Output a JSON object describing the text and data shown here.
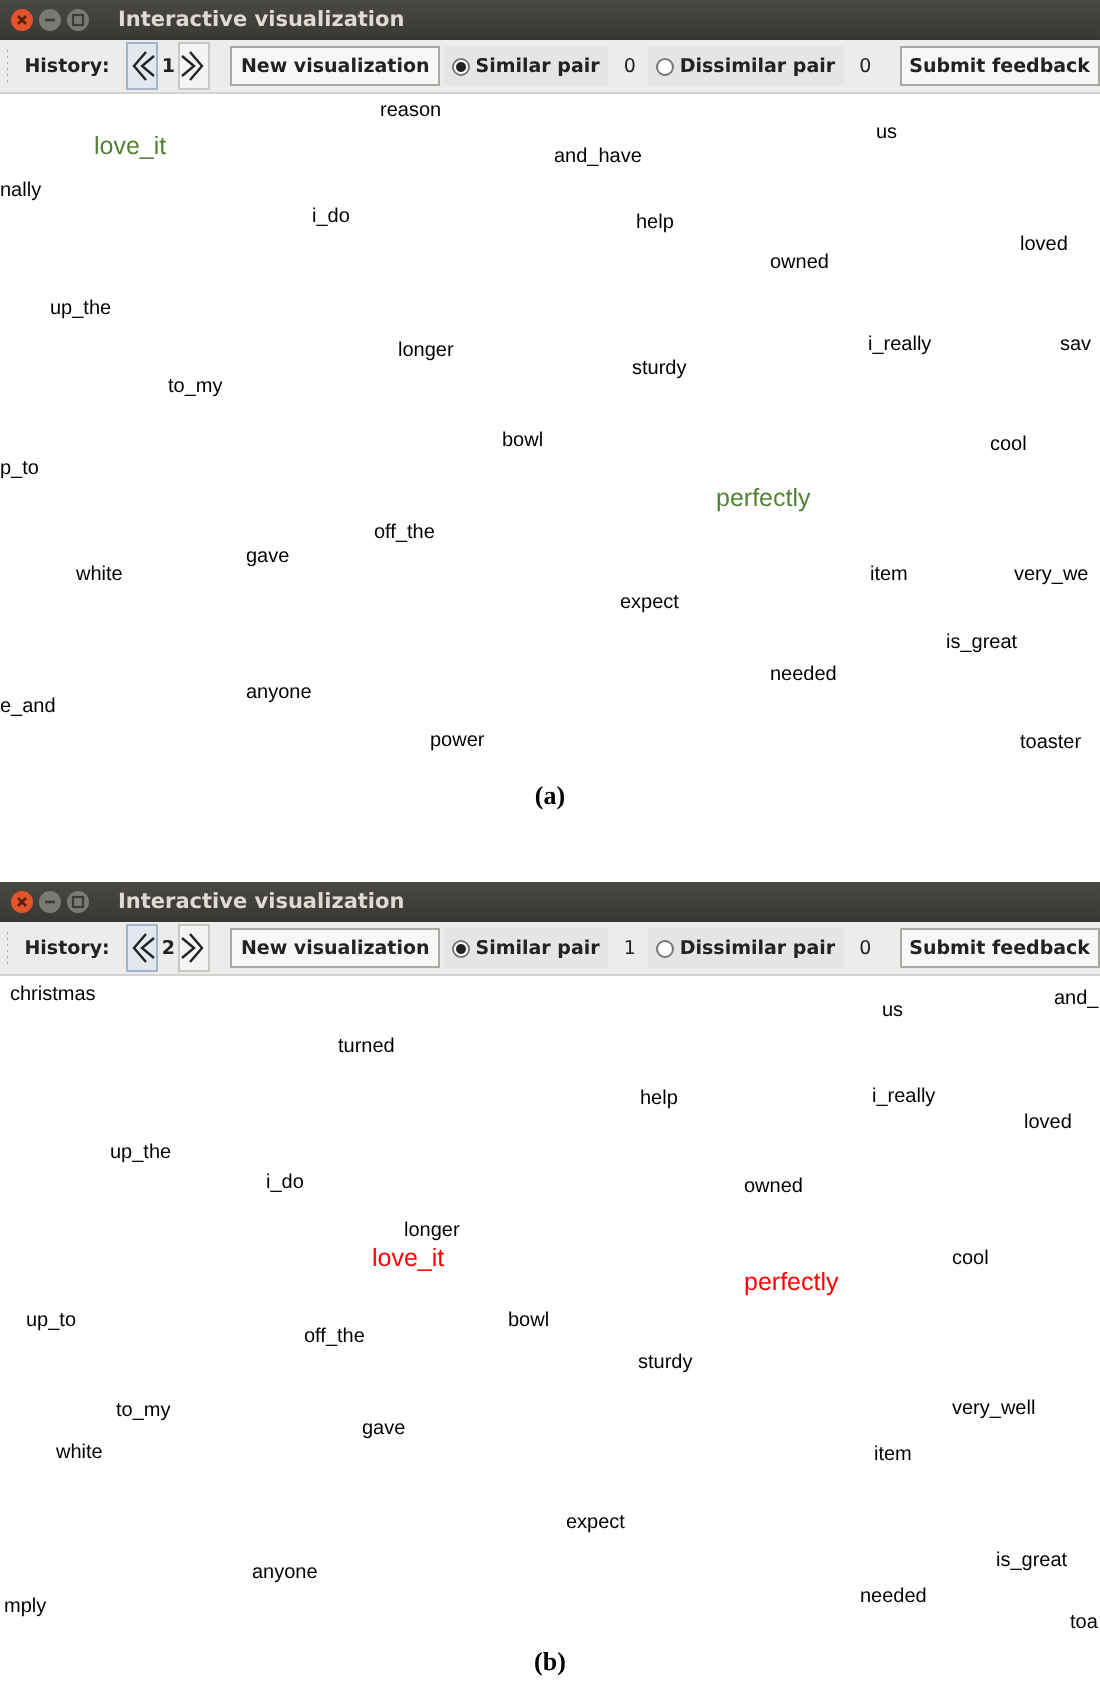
{
  "panels": [
    {
      "window": {
        "title": "Interactive visualization"
      },
      "toolbar": {
        "history_label": "History:",
        "page": "1",
        "new_button": "New visualization",
        "options": [
          {
            "label": "Similar pair",
            "selected": true,
            "count": "0"
          },
          {
            "label": "Dissimilar pair",
            "selected": false,
            "count": "0"
          }
        ],
        "submit_button": "Submit feedback"
      },
      "words": [
        {
          "text": "reason",
          "color": "#000000"
        },
        {
          "text": "love_it",
          "color": "#548235"
        },
        {
          "text": "us",
          "color": "#000000"
        },
        {
          "text": "and_have",
          "color": "#000000"
        },
        {
          "text": "nally",
          "color": "#000000"
        },
        {
          "text": "i_do",
          "color": "#000000"
        },
        {
          "text": "help",
          "color": "#000000"
        },
        {
          "text": "loved",
          "color": "#000000"
        },
        {
          "text": "owned",
          "color": "#000000"
        },
        {
          "text": "up_the",
          "color": "#000000"
        },
        {
          "text": "longer",
          "color": "#000000"
        },
        {
          "text": "i_really",
          "color": "#000000"
        },
        {
          "text": "sav",
          "color": "#000000"
        },
        {
          "text": "sturdy",
          "color": "#000000"
        },
        {
          "text": "to_my",
          "color": "#000000"
        },
        {
          "text": "bowl",
          "color": "#000000"
        },
        {
          "text": "cool",
          "color": "#000000"
        },
        {
          "text": "p_to",
          "color": "#000000"
        },
        {
          "text": "perfectly",
          "color": "#548235"
        },
        {
          "text": "off_the",
          "color": "#000000"
        },
        {
          "text": "gave",
          "color": "#000000"
        },
        {
          "text": "white",
          "color": "#000000"
        },
        {
          "text": "item",
          "color": "#000000"
        },
        {
          "text": "very_we",
          "color": "#000000"
        },
        {
          "text": "expect",
          "color": "#000000"
        },
        {
          "text": "is_great",
          "color": "#000000"
        },
        {
          "text": "needed",
          "color": "#000000"
        },
        {
          "text": "anyone",
          "color": "#000000"
        },
        {
          "text": "e_and",
          "color": "#000000"
        },
        {
          "text": "power",
          "color": "#000000"
        },
        {
          "text": "toaster",
          "color": "#000000"
        }
      ],
      "caption": "(a)"
    },
    {
      "window": {
        "title": "Interactive visualization"
      },
      "toolbar": {
        "history_label": "History:",
        "page": "2",
        "new_button": "New visualization",
        "options": [
          {
            "label": "Similar pair",
            "selected": true,
            "count": "1"
          },
          {
            "label": "Dissimilar pair",
            "selected": false,
            "count": "0"
          }
        ],
        "submit_button": "Submit feedback"
      },
      "words": [
        {
          "text": "christmas",
          "color": "#000000"
        },
        {
          "text": "us",
          "color": "#000000"
        },
        {
          "text": "and_",
          "color": "#000000"
        },
        {
          "text": "turned",
          "color": "#000000"
        },
        {
          "text": "help",
          "color": "#000000"
        },
        {
          "text": "i_really",
          "color": "#000000"
        },
        {
          "text": "loved",
          "color": "#000000"
        },
        {
          "text": "up_the",
          "color": "#000000"
        },
        {
          "text": "i_do",
          "color": "#000000"
        },
        {
          "text": "owned",
          "color": "#000000"
        },
        {
          "text": "longer",
          "color": "#000000"
        },
        {
          "text": "love_it",
          "color": "#ff0000"
        },
        {
          "text": "cool",
          "color": "#000000"
        },
        {
          "text": "perfectly",
          "color": "#ff0000"
        },
        {
          "text": "up_to",
          "color": "#000000"
        },
        {
          "text": "bowl",
          "color": "#000000"
        },
        {
          "text": "off_the",
          "color": "#000000"
        },
        {
          "text": "sturdy",
          "color": "#000000"
        },
        {
          "text": "to_my",
          "color": "#000000"
        },
        {
          "text": "very_well",
          "color": "#000000"
        },
        {
          "text": "gave",
          "color": "#000000"
        },
        {
          "text": "white",
          "color": "#000000"
        },
        {
          "text": "item",
          "color": "#000000"
        },
        {
          "text": "expect",
          "color": "#000000"
        },
        {
          "text": "is_great",
          "color": "#000000"
        },
        {
          "text": "anyone",
          "color": "#000000"
        },
        {
          "text": "needed",
          "color": "#000000"
        },
        {
          "text": "mply",
          "color": "#000000"
        },
        {
          "text": "toa",
          "color": "#000000"
        }
      ],
      "caption": "(b)"
    }
  ]
}
